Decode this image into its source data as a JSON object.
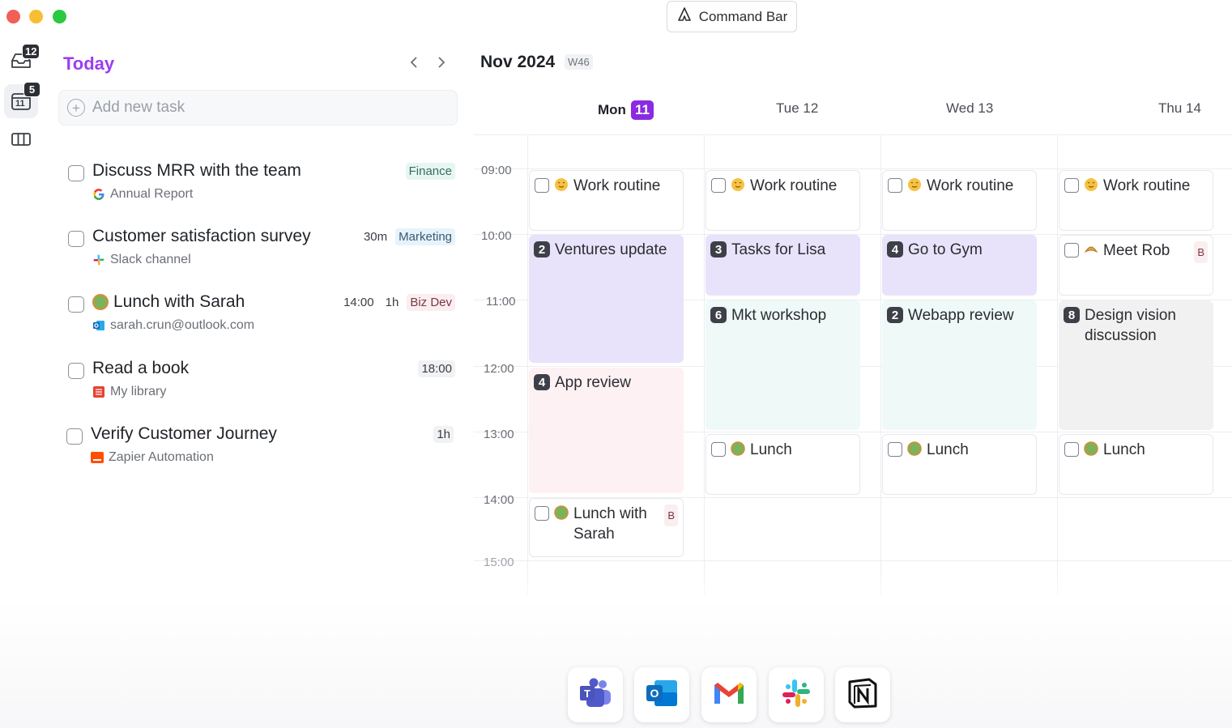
{
  "command_bar": {
    "label": "Command Bar",
    "icon": "command-bar-icon"
  },
  "rail": {
    "inbox_badge": "12",
    "today_badge": "5",
    "today_icon_text": "11"
  },
  "tasks_panel": {
    "title": "Today",
    "add_placeholder": "Add new task",
    "tasks": [
      {
        "title": "Discuss MRR with the team",
        "source": "Annual Report",
        "source_icon": "google-icon",
        "tags": [
          "Finance"
        ]
      },
      {
        "title": "Customer satisfaction survey",
        "source": "Slack channel",
        "source_icon": "slack-icon",
        "duration": "30m",
        "tags": [
          "Marketing"
        ]
      },
      {
        "title": "Lunch with Sarah",
        "source": "sarah.crun@outlook.com",
        "source_icon": "outlook-icon",
        "time": "14:00",
        "duration": "1h",
        "tags": [
          "Biz Dev"
        ]
      },
      {
        "title": "Read a book",
        "source": "My library",
        "source_icon": "book-icon",
        "time": "18:00"
      },
      {
        "title": "Verify Customer Journey",
        "source": "Zapier Automation",
        "source_icon": "zapier-icon",
        "duration": "1h"
      }
    ]
  },
  "calendar": {
    "month": "Nov 2024",
    "week": "W46",
    "days": [
      {
        "name": "Mon",
        "num": "11",
        "today": true
      },
      {
        "name": "Tue 12"
      },
      {
        "name": "Wed 13"
      },
      {
        "name": "Thu 14"
      }
    ],
    "hours": [
      "09:00",
      "10:00",
      "11:00",
      "12:00",
      "13:00",
      "14:00",
      "15:00"
    ],
    "events": {
      "mon_work": "Work routine",
      "tue_work": "Work routine",
      "wed_work": "Work routine",
      "thu_work": "Work routine",
      "mon_ventures": {
        "num": "2",
        "title": "Ventures update"
      },
      "tue_lisa": {
        "num": "3",
        "title": "Tasks for Lisa"
      },
      "wed_gym": {
        "num": "4",
        "title": "Go to Gym"
      },
      "thu_rob": {
        "title": "Meet Rob",
        "badge": "B"
      },
      "tue_mkt": {
        "num": "6",
        "title": "Mkt workshop"
      },
      "wed_webapp": {
        "num": "2",
        "title": "Webapp review"
      },
      "thu_design": {
        "num": "8",
        "title": "Design vision discussion"
      },
      "mon_app": {
        "num": "4",
        "title": "App review"
      },
      "tue_lunch": "Lunch",
      "wed_lunch": "Lunch",
      "thu_lunch": "Lunch",
      "mon_lunch_sarah": {
        "title": "Lunch with Sarah",
        "badge": "B"
      }
    }
  },
  "dock": [
    "teams-icon",
    "outlook-icon",
    "gmail-icon",
    "slack-icon",
    "notion-icon"
  ],
  "colors": {
    "accent": "#9b3df0",
    "today_badge": "#8a2be2"
  }
}
